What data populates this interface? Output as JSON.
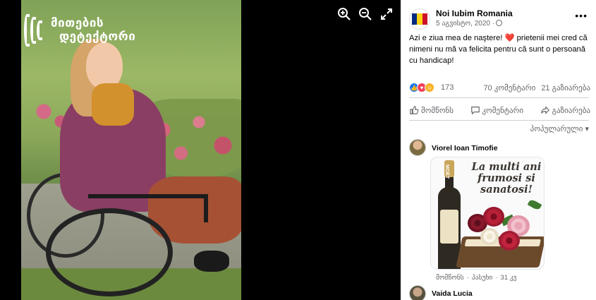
{
  "viewer": {
    "logo_line1": "მითების",
    "logo_line2": "დეტექტორი",
    "tools": [
      "zoom-in-icon",
      "zoom-out-icon",
      "fullscreen-icon"
    ]
  },
  "post": {
    "page_name": "Noi Iubim Romania",
    "date": "5 აგვისტო, 2020 ·",
    "text_before_heart": "Azi e ziua mea de naştere! ",
    "heart": "❤️",
    "text_after_heart": " prietenii mei cred că nimeni nu mă va felicita pentru că sunt o persoană cu handicap!",
    "flag_colors": [
      "#002B7F",
      "#FCD116",
      "#CE1126"
    ]
  },
  "stats": {
    "reaction_count": "173",
    "comments": "70 კომენტარი",
    "shares": "21 გაზიარება"
  },
  "actions": {
    "like": "მომწონს",
    "comment": "კომენტარი",
    "share": "გაზიარება"
  },
  "sort_label": "პოპულარული",
  "comments": [
    {
      "author": "Viorel Ioan Timofie",
      "image_text": "La multi ani frumosi si sanatosi!",
      "bottle_label": "MOËT",
      "like_label": "მომწონს",
      "reply_label": "პასუხი",
      "time": "31 კვ"
    },
    {
      "author": "Vaida Lucia"
    }
  ]
}
